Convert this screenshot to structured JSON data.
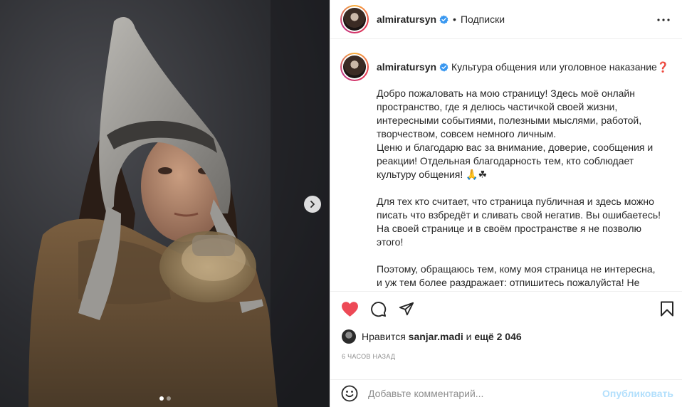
{
  "post": {
    "username": "almiratursyn",
    "follow_label": "Подписки",
    "bullet": "•",
    "caption_title": "Культура общения или уголовное наказание",
    "caption_title_emoji": "❓",
    "caption_body": "Добро пожаловать на мою страницу! Здесь моё онлайн пространство, где я делюсь частичкой своей жизни, интересными событиями, полезными мыслями, работой, творчеством, совсем немного личным.\nЦеню и благодарю вас за внимание, доверие, сообщения и реакции! Отдельная благодарность тем, кто соблюдает культуру общения! 🙏☘\n\nДля тех кто считает, что страница публичная и здесь можно писать что взбредёт и сливать свой негатив. Вы ошибаетесь! На своей странице и в своём пространстве я не позволю этого!\n\nПоэтому, обращаюсь тем, кому моя страница не интересна, и уж тем более раздражает: отпишитесь пожалуйста! Не мучайте себя и не тратьте моё время!",
    "likes_prefix": "Нравится",
    "likes_user": "sanjar.madi",
    "likes_and": "и",
    "likes_count": "ещё 2 046",
    "time_ago": "6 часов назад",
    "comment_placeholder": "Добавьте комментарий...",
    "publish_label": "Опубликовать",
    "carousel": {
      "total": 2,
      "current": 1
    }
  },
  "icons": {
    "like": "heart-filled-icon",
    "comment": "speech-bubble-icon",
    "share": "paper-plane-icon",
    "save": "bookmark-icon",
    "more": "three-dots-icon",
    "emoji": "smiley-icon",
    "next": "chevron-right-icon",
    "verified": "verified-badge-icon"
  },
  "colors": {
    "like_red": "#ed4956",
    "verified_blue": "#3897f0",
    "publish_disabled": "#b2dffc",
    "muted_text": "#8e8e8e"
  }
}
